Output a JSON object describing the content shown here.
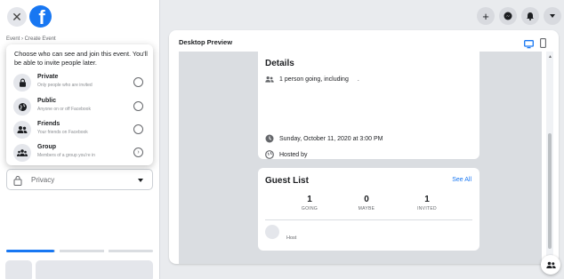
{
  "header": {
    "close_icon": "close-icon",
    "logo_letter": "f",
    "breadcrumb": "Event › Create Event"
  },
  "privacy_dropdown": {
    "description": "Choose who can see and join this event. You'll be able to invite people later.",
    "options": [
      {
        "title": "Private",
        "subtitle": "Only people who are invited",
        "icon": "lock-icon",
        "control": "radio"
      },
      {
        "title": "Public",
        "subtitle": "Anyone on or off Facebook",
        "icon": "globe-icon",
        "control": "radio"
      },
      {
        "title": "Friends",
        "subtitle": "Your friends on Facebook",
        "icon": "friends-icon",
        "control": "radio"
      },
      {
        "title": "Group",
        "subtitle": "Members of a group you're in",
        "icon": "group-icon",
        "control": "chevron"
      }
    ]
  },
  "privacy_select": {
    "value": "Privacy",
    "icon": "lock-icon"
  },
  "progress": {
    "fraction": 0.33
  },
  "topbar": {
    "icons": [
      "plus-icon",
      "messenger-icon",
      "notifications-icon",
      "account-menu-icon"
    ]
  },
  "preview": {
    "title": "Desktop Preview",
    "details": {
      "heading": "Details",
      "going": "1 person going, including",
      "going_suffix": ".",
      "date": "Sunday, October 11, 2020 at 3:00 PM",
      "hosted_by": "Hosted by"
    },
    "guest_list": {
      "heading": "Guest List",
      "see_all": "See All",
      "stats": [
        {
          "value": "1",
          "label": "GOING"
        },
        {
          "value": "0",
          "label": "MAYBE"
        },
        {
          "value": "1",
          "label": "INVITED"
        }
      ],
      "host_label": "Host"
    }
  },
  "colors": {
    "brand": "#1877f2",
    "background": "#e9ebee"
  }
}
